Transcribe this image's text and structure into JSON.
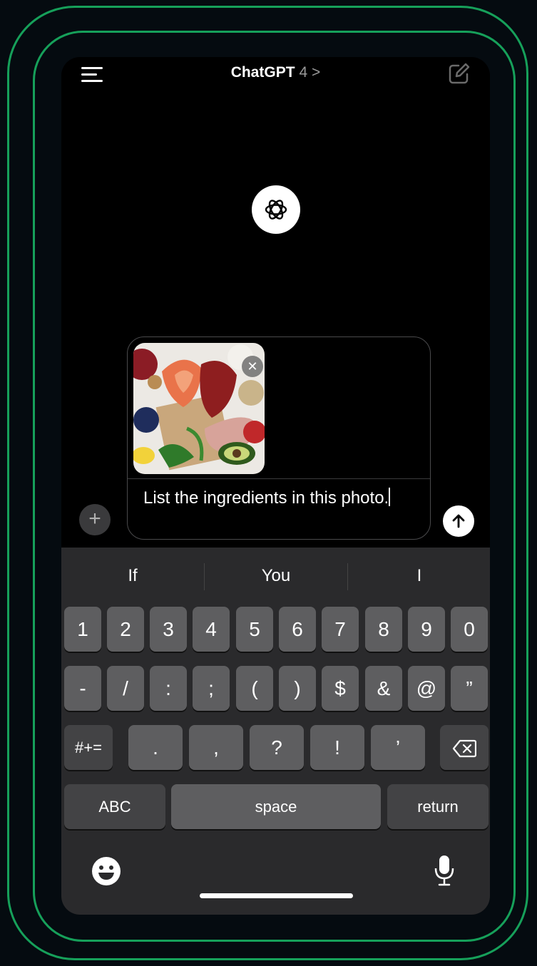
{
  "header": {
    "title": "ChatGPT",
    "version": "4 >"
  },
  "composer": {
    "text": "List the ingredients in this photo.",
    "remove_icon": "close-icon",
    "image_alt": "food-photo-thumbnail"
  },
  "keyboard": {
    "suggestions": [
      "If",
      "You",
      "I"
    ],
    "row1": [
      "1",
      "2",
      "3",
      "4",
      "5",
      "6",
      "7",
      "8",
      "9",
      "0"
    ],
    "row2": [
      "-",
      "/",
      ":",
      ";",
      "(",
      ")",
      "$",
      "&",
      "@",
      "”"
    ],
    "row3": {
      "symbols": "#+=",
      "keys": [
        ".",
        ",",
        "?",
        "!",
        "’"
      ]
    },
    "row4": {
      "abc": "ABC",
      "space": "space",
      "return": "return"
    }
  },
  "colors": {
    "frame": "#16a05a",
    "background": "#000000",
    "key": "#5e5e60",
    "key_fn": "#434345"
  }
}
